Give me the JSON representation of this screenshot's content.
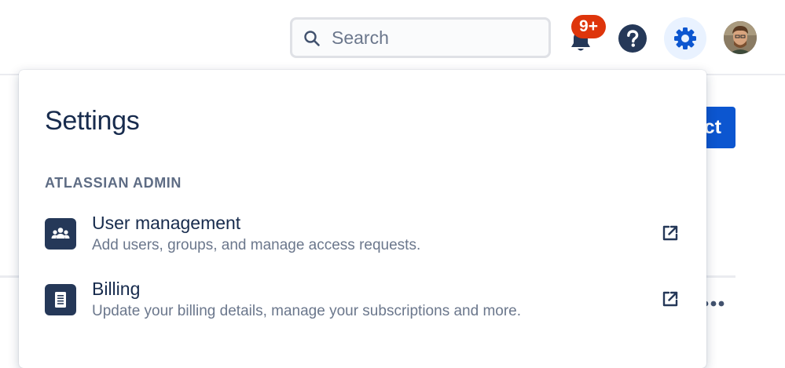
{
  "header": {
    "search": {
      "placeholder": "Search",
      "value": ""
    },
    "notifications": {
      "badge": "9+",
      "icon": "bell-icon",
      "badge_color": "#de350b"
    },
    "help": {
      "icon": "question-icon"
    },
    "settings": {
      "icon": "gear-icon",
      "active": true,
      "accent": "#0c56d0"
    },
    "avatar": {
      "icon": "user-avatar"
    }
  },
  "background": {
    "primary_button_fragment": "ct",
    "more_icon": "more-horizontal-icon"
  },
  "settings_panel": {
    "title": "Settings",
    "sections": [
      {
        "heading": "ATLASSIAN ADMIN",
        "items": [
          {
            "title": "User management",
            "description": "Add users, groups, and manage access requests.",
            "icon": "people-icon",
            "external": true
          },
          {
            "title": "Billing",
            "description": "Update your billing details, manage your subscriptions and more.",
            "icon": "invoice-icon",
            "external": true
          }
        ]
      }
    ]
  },
  "colors": {
    "text_primary": "#172b4d",
    "text_subtle": "#6b778c",
    "section_heading": "#5e6c84",
    "icon_tile": "#253858",
    "brand_blue": "#0c56d0"
  }
}
